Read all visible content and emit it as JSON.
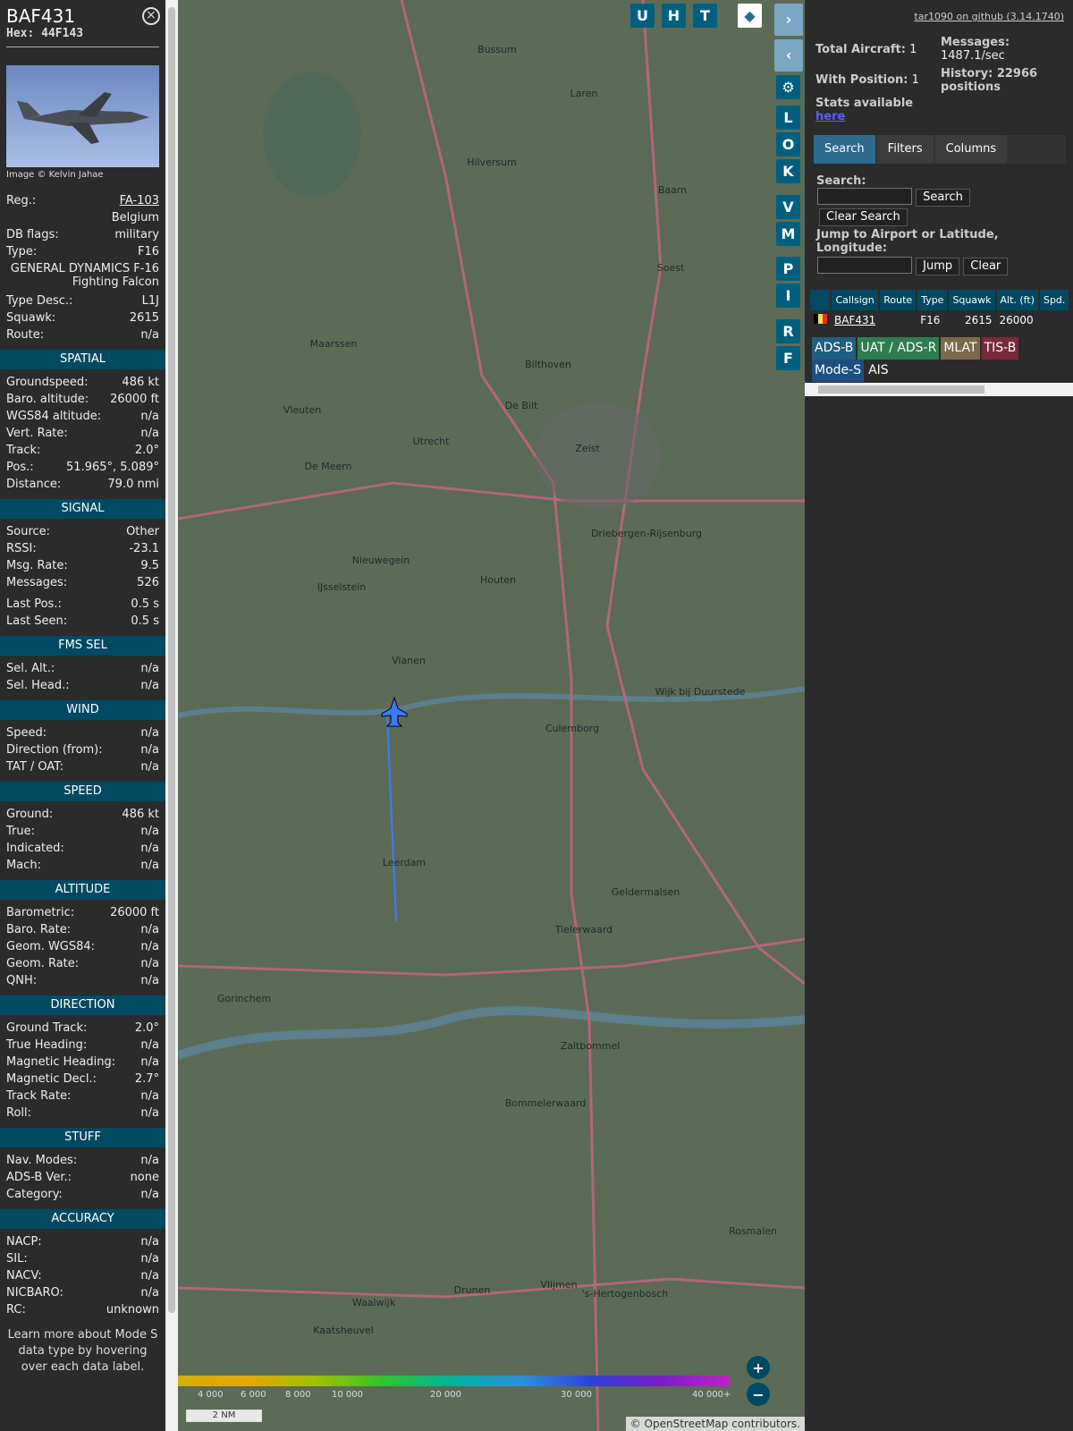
{
  "details": {
    "callsign": "BAF431",
    "hex": "Hex:  44F143",
    "photo_credit": "Image © Kelvin Jahae",
    "reg_label": "Reg.:",
    "reg": "FA-103",
    "country": "Belgium",
    "dbflags_label": "DB flags:",
    "dbflags": "military",
    "type_label": "Type:",
    "type": "F16",
    "type_full": "GENERAL DYNAMICS F-16 Fighting Falcon",
    "typedesc_label": "Type Desc.:",
    "typedesc": "L1J",
    "squawk_label": "Squawk:",
    "squawk": "2615",
    "route_label": "Route:",
    "route": "n/a"
  },
  "spatial": {
    "title": "SPATIAL",
    "rows": [
      [
        "Groundspeed:",
        "486 kt"
      ],
      [
        "Baro. altitude:",
        "26000 ft"
      ],
      [
        "WGS84 altitude:",
        "n/a"
      ],
      [
        "Vert. Rate:",
        "n/a"
      ],
      [
        "Track:",
        "2.0°"
      ],
      [
        "Pos.:",
        "51.965°, 5.089°"
      ],
      [
        "Distance:",
        "79.0 nmi"
      ]
    ]
  },
  "signal": {
    "title": "SIGNAL",
    "rows": [
      [
        "Source:",
        "Other"
      ],
      [
        "RSSI:",
        "-23.1"
      ],
      [
        "Msg. Rate:",
        "9.5"
      ],
      [
        "Messages:",
        "526"
      ]
    ],
    "rows2": [
      [
        "Last Pos.:",
        "0.5 s"
      ],
      [
        "Last Seen:",
        "0.5 s"
      ]
    ]
  },
  "fms": {
    "title": "FMS SEL",
    "rows": [
      [
        "Sel. Alt.:",
        "n/a"
      ],
      [
        "Sel. Head.:",
        "n/a"
      ]
    ]
  },
  "wind": {
    "title": "WIND",
    "rows": [
      [
        "Speed:",
        "n/a"
      ],
      [
        "Direction (from):",
        "n/a"
      ],
      [
        "TAT / OAT:",
        "n/a"
      ]
    ]
  },
  "speed": {
    "title": "SPEED",
    "rows": [
      [
        "Ground:",
        "486 kt"
      ],
      [
        "True:",
        "n/a"
      ],
      [
        "Indicated:",
        "n/a"
      ],
      [
        "Mach:",
        "n/a"
      ]
    ]
  },
  "altitude": {
    "title": "ALTITUDE",
    "rows": [
      [
        "Barometric:",
        "26000 ft"
      ],
      [
        "Baro. Rate:",
        "n/a"
      ],
      [
        "Geom. WGS84:",
        "n/a"
      ],
      [
        "Geom. Rate:",
        "n/a"
      ],
      [
        "QNH:",
        "n/a"
      ]
    ]
  },
  "direction": {
    "title": "DIRECTION",
    "rows": [
      [
        "Ground Track:",
        "2.0°"
      ],
      [
        "True Heading:",
        "n/a"
      ],
      [
        "Magnetic Heading:",
        "n/a"
      ],
      [
        "Magnetic Decl.:",
        "2.7°"
      ],
      [
        "Track Rate:",
        "n/a"
      ],
      [
        "Roll:",
        "n/a"
      ]
    ]
  },
  "stuff": {
    "title": "STUFF",
    "rows": [
      [
        "Nav. Modes:",
        "n/a"
      ],
      [
        "ADS-B Ver.:",
        "none"
      ],
      [
        "Category:",
        "n/a"
      ]
    ]
  },
  "accuracy": {
    "title": "ACCURACY",
    "rows": [
      [
        "NACP:",
        "n/a"
      ],
      [
        "SIL:",
        "n/a"
      ],
      [
        "NACV:",
        "n/a"
      ],
      [
        "NICBARO:",
        "n/a"
      ],
      [
        "RC:",
        "unknown"
      ]
    ]
  },
  "footer": "Learn more about Mode S data type by hovering over each data label.",
  "map": {
    "buttons": [
      "U",
      "H",
      "T"
    ],
    "side": [
      "L",
      "O",
      "K",
      "V",
      "M",
      "P",
      "I",
      "R",
      "F"
    ],
    "places": [
      [
        "Hilversum",
        530,
        185
      ],
      [
        "Utrecht",
        462,
        497
      ],
      [
        "Nieuwegein",
        406,
        630
      ],
      [
        "IJsselstein",
        362,
        660
      ],
      [
        "Houten",
        537,
        652
      ],
      [
        "Vianen",
        437,
        742
      ],
      [
        "Culemborg",
        620,
        818
      ],
      [
        "Leerdam",
        432,
        968
      ],
      [
        "Gorinchem",
        253,
        1120
      ],
      [
        "Zaltbommel",
        640,
        1173
      ],
      [
        "Tielerwaard",
        633,
        1043
      ],
      [
        "Bommelerwaard",
        590,
        1237
      ],
      [
        "Zeist",
        637,
        505
      ],
      [
        "De Bilt",
        563,
        457
      ],
      [
        "Bilthoven",
        593,
        411
      ],
      [
        "Maarssen",
        353,
        388
      ],
      [
        "Vleuten",
        318,
        462
      ],
      [
        "De Meern",
        347,
        525
      ],
      [
        "Soest",
        730,
        303
      ],
      [
        "Baarn",
        732,
        216
      ],
      [
        "Laren",
        633,
        108
      ],
      [
        "Bussum",
        536,
        59
      ],
      [
        "Driebergen-Rijsenburg",
        703,
        600
      ],
      [
        "Geldermalsen",
        702,
        1001
      ],
      [
        "Wijk bij Duurstede",
        763,
        777
      ],
      [
        "Waalwijk",
        398,
        1460
      ],
      [
        "Drunen",
        508,
        1446
      ],
      [
        "Vlijmen",
        605,
        1440
      ],
      [
        "'s-Hertogenbosch",
        679,
        1450
      ],
      [
        "Rosmalen",
        822,
        1380
      ],
      [
        "Kaatsheuvel",
        364,
        1491
      ]
    ],
    "scale_labels": [
      "4 000",
      "6 000",
      "8 000",
      "10 000",
      "20 000",
      "30 000",
      "40 000+"
    ],
    "scale_text": "2 NM",
    "attribution": "© OpenStreetMap contributors."
  },
  "stats": {
    "total_label": "Total Aircraft:",
    "total": "1",
    "withpos_label": "With Position:",
    "withpos": "1",
    "stats_label": "Stats available",
    "stats_link": "here",
    "msg_label": "Messages:",
    "msg": "1487.1/sec",
    "hist_label": "History: 22966 positions",
    "github": "tar1090 on github (3.14.1740)"
  },
  "tabs": [
    "Search",
    "Filters",
    "Columns"
  ],
  "search": {
    "label": "Search:",
    "btn": "Search",
    "clear": "Clear Search",
    "jump_label": "Jump to Airport or Latitude, Longitude:",
    "jump": "Jump",
    "jclear": "Clear"
  },
  "table": {
    "headers": [
      "Callsign",
      "Route",
      "Type",
      "Squawk",
      "Alt. (ft)",
      "Spd."
    ],
    "row": [
      "BAF431",
      "",
      "F16",
      "2615",
      "26000",
      ""
    ]
  },
  "legend": [
    "ADS-B",
    "UAT / ADS-R",
    "MLAT",
    "TIS-B",
    "Mode-S",
    "AIS"
  ],
  "colors": {
    "header": "#004963",
    "map": "#5b6b56",
    "track": "#3a7bff"
  }
}
